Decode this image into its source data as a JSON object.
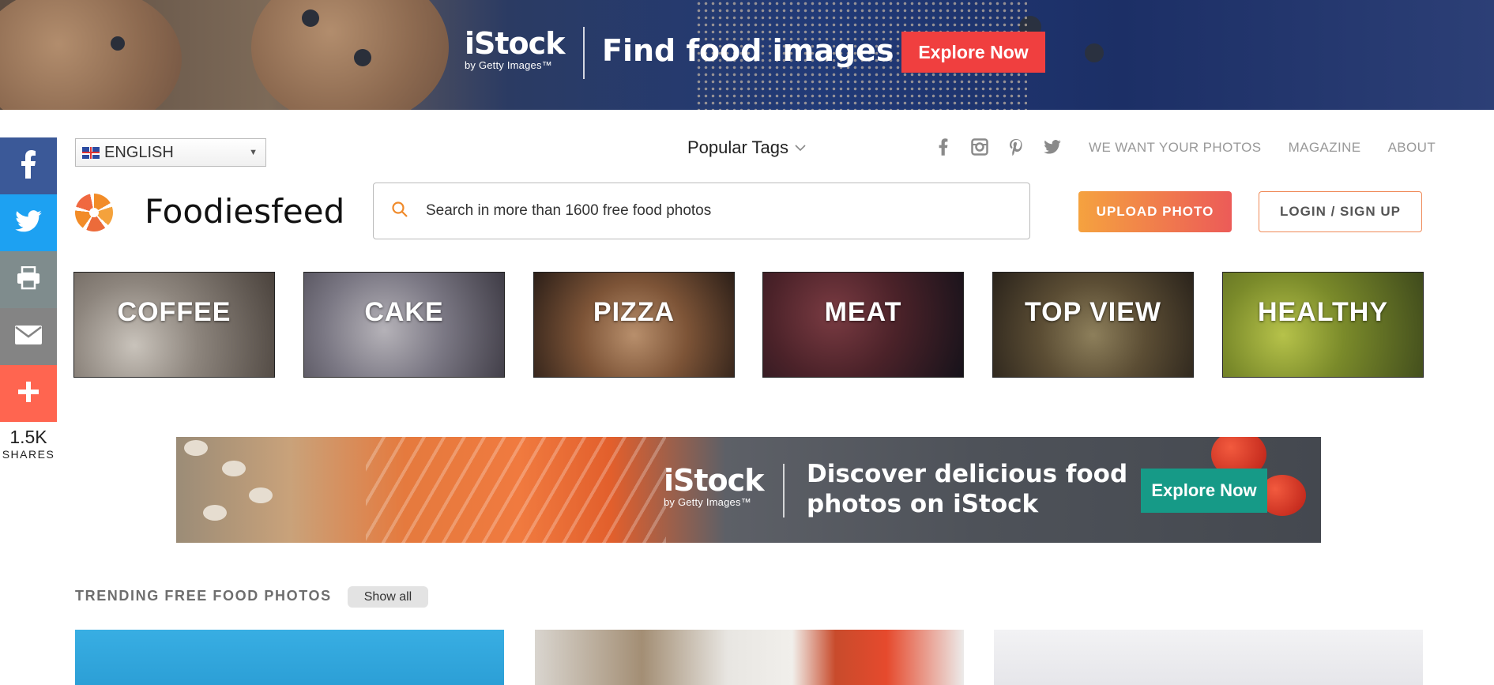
{
  "top_banner": {
    "logo": "iStock",
    "logo_sub": "by Getty Images™",
    "headline": "Find food images",
    "cta": "Explore Now",
    "accent_color": "#f03f3f"
  },
  "share_bar": {
    "buttons": [
      {
        "name": "facebook",
        "icon": "facebook-icon",
        "color": "#3b5998"
      },
      {
        "name": "twitter",
        "icon": "twitter-icon",
        "color": "#1da1f2"
      },
      {
        "name": "print",
        "icon": "print-icon",
        "color": "#7f8c8d"
      },
      {
        "name": "email",
        "icon": "email-icon",
        "color": "#848484"
      },
      {
        "name": "more",
        "icon": "plus-icon",
        "color": "#ff6550"
      }
    ],
    "count": "1.5K",
    "count_label": "SHARES"
  },
  "header": {
    "language": "ENGLISH",
    "popular_tags": "Popular Tags",
    "social_icons": [
      "facebook-icon",
      "instagram-icon",
      "pinterest-icon",
      "twitter-icon"
    ],
    "nav": [
      "WE WANT YOUR PHOTOS",
      "MAGAZINE",
      "ABOUT"
    ],
    "site_name": "Foodiesfeed",
    "search_placeholder": "Search in more than 1600 free food photos",
    "upload_label": "UPLOAD PHOTO",
    "login_label": "LOGIN / SIGN UP"
  },
  "categories": [
    "COFFEE",
    "CAKE",
    "PIZZA",
    "MEAT",
    "TOP VIEW",
    "HEALTHY"
  ],
  "mid_banner": {
    "logo": "iStock",
    "logo_sub": "by Getty Images™",
    "text_line1": "Discover delicious food",
    "text_line2": "photos on iStock",
    "cta": "Explore Now",
    "accent_color": "#169a87"
  },
  "trending": {
    "title": "TRENDING FREE FOOD PHOTOS",
    "show_all": "Show all"
  }
}
